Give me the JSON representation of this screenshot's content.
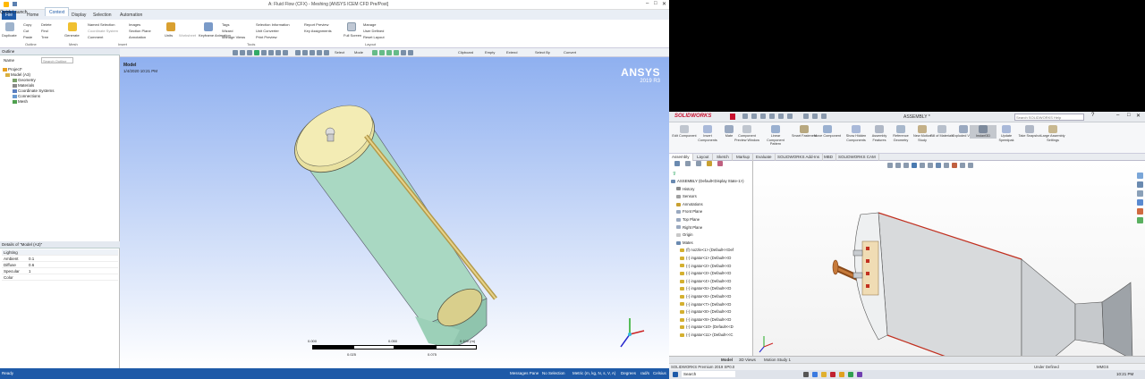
{
  "ansys": {
    "title": "A: Fluid Flow (CFX) - Meshing [ANSYS ICEM CFD Pre/Post]",
    "search_placeholder": "Quick Launch",
    "tabs": [
      "File",
      "Home",
      "Context",
      "Display",
      "Selection",
      "Automation"
    ],
    "ribbon": {
      "clipboard": [
        "Duplicate",
        "Copy",
        "Cut",
        "Paste",
        "Delete",
        "Find",
        "Tree"
      ],
      "outline_group": "Outline",
      "generate": "Generate",
      "mesh_group": "Mesh",
      "insert_items": [
        "Named Selection",
        "Coordinate System",
        "Comment",
        "Images",
        "Section Plane",
        "Annotation"
      ],
      "insert_group": "Insert",
      "units": "Units",
      "worksheet": "Worksheet",
      "keyframe": "Keyframe Animation",
      "tools_items": [
        "Tags",
        "Wizard",
        "Manage Views",
        "Selection Information",
        "Unit Converter",
        "Print Preview",
        "Report Preview",
        "Key Assignments"
      ],
      "tools_group": "Tools",
      "full_screen": "Full Screen",
      "layout_items": [
        "Manage",
        "User Defined",
        "Reset Layout"
      ],
      "layout_group": "Layout"
    },
    "toolbar_items": [
      "Select",
      "Mode",
      "Clipboard",
      "Empty",
      "Extend",
      "Select By",
      "Convert"
    ],
    "outline": {
      "header": "Outline",
      "search_placeholder": "Search Outline",
      "name_label": "Name",
      "tree": [
        "Project*",
        "Model (A3)",
        "Geometry",
        "Materials",
        "Coordinate Systems",
        "Connections",
        "Mesh"
      ]
    },
    "details": {
      "header": "Details of \"Model (A3)\"",
      "rows": [
        "Lighting",
        "Ambient",
        "Diffuse",
        "Specular",
        "Color"
      ],
      "values": [
        "",
        "0.1",
        "0.6",
        "1",
        ""
      ]
    },
    "graphics": {
      "label1": "Model",
      "label2": "1/4/2020 10:21 PM",
      "logo": "ANSYS",
      "version": "2019 R3",
      "scale_labels": [
        "0.000",
        "0.050",
        "0.100 (m)",
        "0.025",
        "0.075"
      ]
    },
    "status": [
      "Ready",
      "Messages Pane",
      "No Selection",
      "Metric (m, kg, N, s, V, A)",
      "Degrees",
      "rad/s",
      "Celsius"
    ]
  },
  "sw": {
    "logo": "SOLIDWORKS",
    "doc_title": "ASSEMBLY *",
    "search_placeholder": "Search SOLIDWORKS Help",
    "commands": [
      "Edit Component",
      "Insert Components",
      "Mate",
      "Component Preview Window",
      "Linear Component Pattern",
      "Smart Fasteners",
      "Move Component",
      "Show Hidden Components",
      "Assembly Features",
      "Reference Geometry",
      "New Motion Study",
      "Bill of Materials",
      "Exploded View",
      "Instant3D",
      "Update Speedpak",
      "Take Snapshot",
      "Large Assembly Settings"
    ],
    "tabs": [
      "Assembly",
      "Layout",
      "Sketch",
      "Markup",
      "Evaluate",
      "SOLIDWORKS Add-Ins",
      "MBD",
      "SOLIDWORKS CAM"
    ],
    "tree": [
      "ASSEMBLY (Default<Display State-1>)",
      "History",
      "Sensors",
      "Annotations",
      "Front Plane",
      "Top Plane",
      "Right Plane",
      "Origin",
      "Mates",
      "(f) nozzle<1> (Default<<Def",
      "(-) ingator<1> (Default<<D",
      "(-) ingator<2> (Default<<D",
      "(-) ingator<3> (Default<<D",
      "(-) ingator<4> (Default<<D",
      "(-) ingator<5> (Default<<D",
      "(-) ingator<6> (Default<<D",
      "(-) ingator<7> (Default<<D",
      "(-) ingator<8> (Default<<D",
      "(-) ingator<9> (Default<<D",
      "(-) ingator<10> (Default<<D",
      "(-) ingator<11> (Default<<C"
    ],
    "bottom_tabs": [
      "Model",
      "3D Views",
      "Motion Study 1"
    ],
    "status_left": "SOLIDWORKS Premium 2019 SP0.0",
    "status_mid": "Under Defined",
    "status_right": "MMGS",
    "taskbar_search": "Search",
    "taskbar_time": "10:21 PM"
  }
}
